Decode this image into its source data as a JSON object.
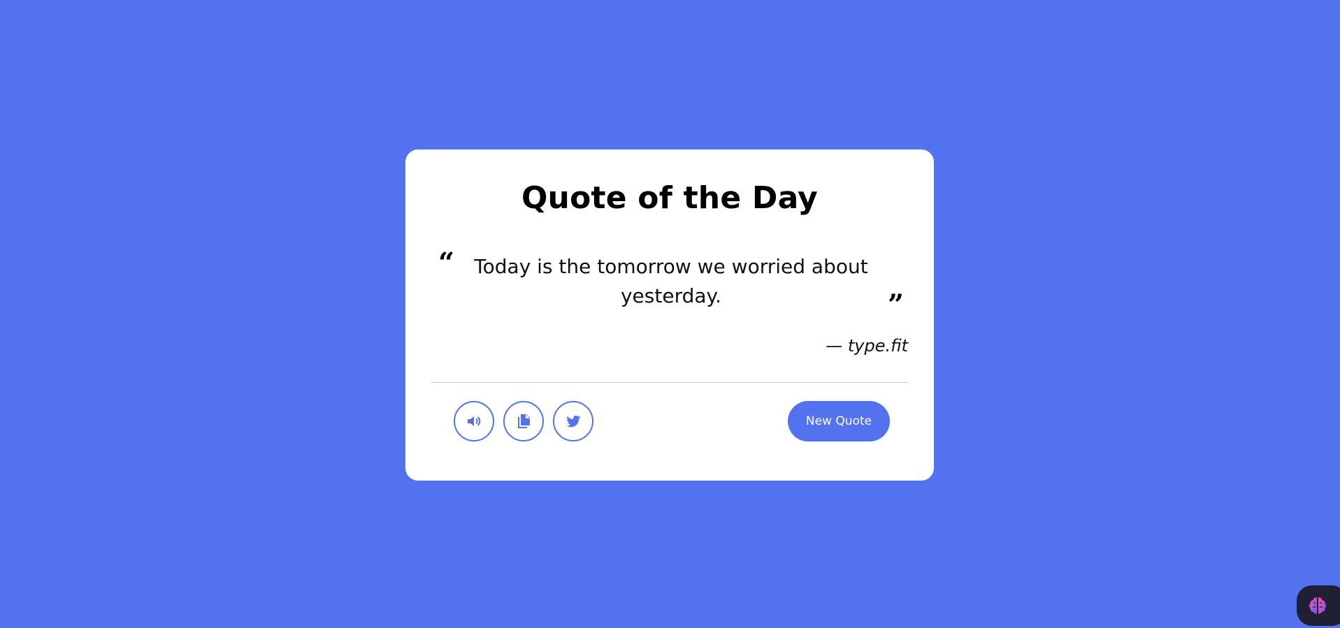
{
  "card": {
    "title": "Quote of the Day",
    "open_mark": "“",
    "quote": "Today is the tomorrow we worried about yesterday.",
    "close_mark": "”",
    "author_dash": "—",
    "author": "type.fit"
  },
  "actions": {
    "sound_icon": "speaker-icon",
    "copy_icon": "copy-icon",
    "tweet_icon": "twitter-icon",
    "new_quote_label": "New Quote"
  },
  "colors": {
    "background": "#5372f0",
    "accent": "#5372f0",
    "card": "#ffffff"
  },
  "widget": {
    "icon": "brain-icon"
  }
}
